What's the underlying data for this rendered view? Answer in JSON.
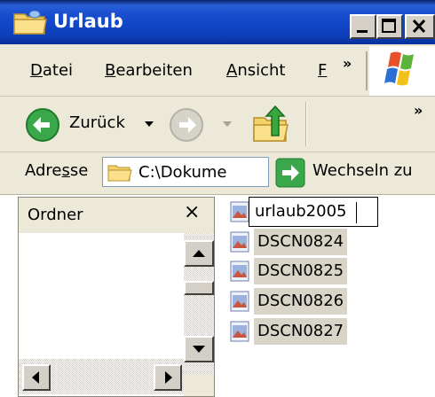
{
  "window": {
    "title": "Urlaub",
    "icons": {
      "title": "folder-icon",
      "minimize": "minimize-icon",
      "maximize": "maximize-icon",
      "close": "close-icon"
    }
  },
  "menubar": {
    "items": [
      {
        "label": "Datei",
        "accesskey": "D"
      },
      {
        "label": "Bearbeiten",
        "accesskey": "B"
      },
      {
        "label": "Ansicht",
        "accesskey": "A"
      },
      {
        "label": "F",
        "accesskey": "F"
      }
    ],
    "overflow": "»",
    "logo_icon": "windows-flag-icon"
  },
  "toolbar": {
    "back_label": "Zurück",
    "overflow": "»",
    "icons": [
      "back-arrow-icon",
      "forward-arrow-icon",
      "folder-up-icon"
    ]
  },
  "address": {
    "label": "Adresse",
    "accesskey": "s",
    "value": "C:\\Dokume",
    "go_label": "Wechseln zu"
  },
  "folder_pane": {
    "title": "Ordner",
    "close_glyph": "×"
  },
  "files": {
    "renaming": "urlaub2005",
    "items": [
      "DSCN0824",
      "DSCN0825",
      "DSCN0826",
      "DSCN0827"
    ]
  },
  "colors": {
    "titlebar": "#0a246a",
    "chrome": "#ece9d8",
    "go_green": "#3aa84a",
    "selection": "#d8d4c8"
  }
}
